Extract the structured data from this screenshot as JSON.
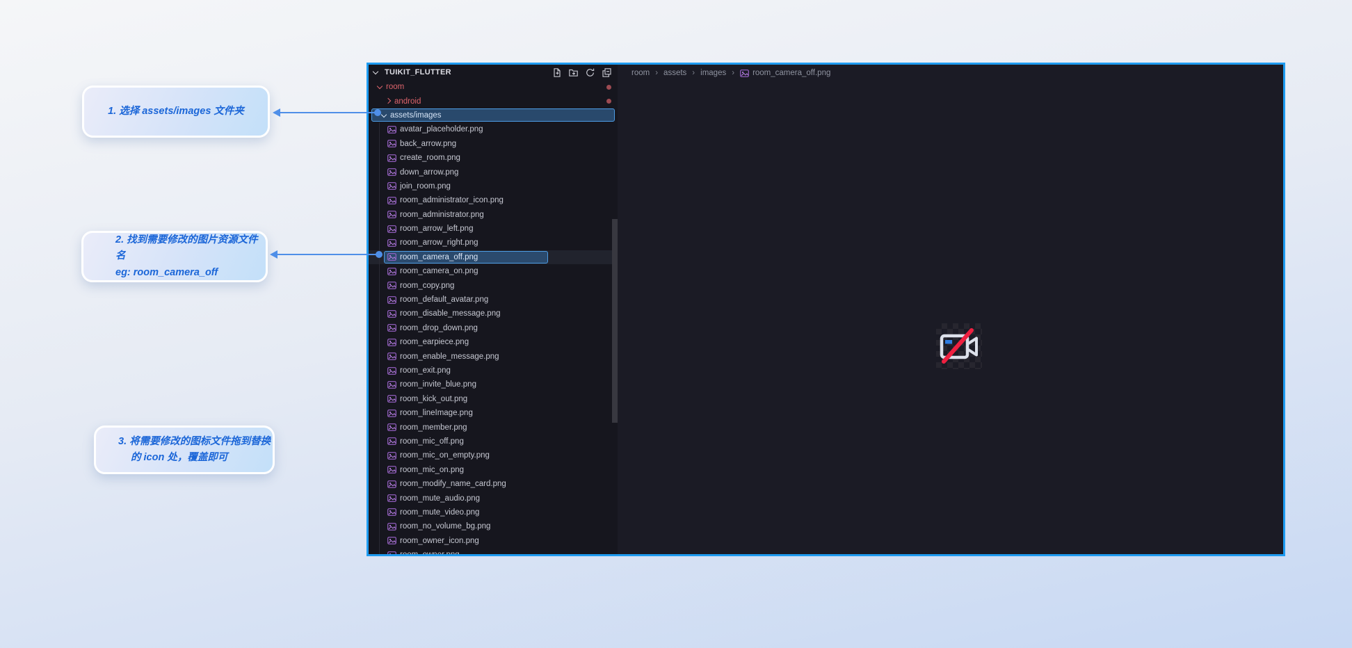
{
  "annotations": {
    "step1": {
      "line1": "1. 选择 assets/images 文件夹"
    },
    "step2": {
      "line1": "2. 找到需要修改的图片资源文件名",
      "line2": "eg: room_camera_off"
    },
    "step3": {
      "line1": "3. 将需要修改的图标文件拖到替换",
      "line2": "的 icon 处，覆盖即可"
    }
  },
  "explorer": {
    "root_label": "TUIKIT_FLUTTER",
    "toolbar": [
      {
        "name": "new-file"
      },
      {
        "name": "new-folder"
      },
      {
        "name": "refresh-explorer"
      },
      {
        "name": "collapse-folders"
      }
    ],
    "folders": {
      "root_project": {
        "label": "room",
        "state": "expanded",
        "modified": true
      },
      "android": {
        "label": "android",
        "state": "collapsed",
        "modified": true
      },
      "assets_images": {
        "label": "assets/images",
        "state": "expanded",
        "selected": true
      }
    },
    "files": [
      {
        "name": "avatar_placeholder.png"
      },
      {
        "name": "back_arrow.png"
      },
      {
        "name": "create_room.png"
      },
      {
        "name": "down_arrow.png"
      },
      {
        "name": "join_room.png"
      },
      {
        "name": "room_administrator_icon.png"
      },
      {
        "name": "room_administrator.png"
      },
      {
        "name": "room_arrow_left.png"
      },
      {
        "name": "room_arrow_right.png"
      },
      {
        "name": "room_camera_off.png",
        "selected": true
      },
      {
        "name": "room_camera_on.png"
      },
      {
        "name": "room_copy.png"
      },
      {
        "name": "room_default_avatar.png"
      },
      {
        "name": "room_disable_message.png"
      },
      {
        "name": "room_drop_down.png"
      },
      {
        "name": "room_earpiece.png"
      },
      {
        "name": "room_enable_message.png"
      },
      {
        "name": "room_exit.png"
      },
      {
        "name": "room_invite_blue.png"
      },
      {
        "name": "room_kick_out.png"
      },
      {
        "name": "room_lineImage.png"
      },
      {
        "name": "room_member.png"
      },
      {
        "name": "room_mic_off.png"
      },
      {
        "name": "room_mic_on_empty.png"
      },
      {
        "name": "room_mic_on.png"
      },
      {
        "name": "room_modify_name_card.png"
      },
      {
        "name": "room_mute_audio.png"
      },
      {
        "name": "room_mute_video.png"
      },
      {
        "name": "room_no_volume_bg.png"
      },
      {
        "name": "room_owner_icon.png"
      },
      {
        "name": "room_owner.png"
      }
    ]
  },
  "breadcrumb": {
    "items": [
      "room",
      "assets",
      "images",
      "room_camera_off.png"
    ]
  },
  "preview": {
    "filename": "room_camera_off.png",
    "icon": "camera-off"
  },
  "colors": {
    "window_border": "#1e9bf0",
    "sidebar_bg": "#16161e",
    "editor_bg": "#1b1b25",
    "selection_bg": "#2b4a6d",
    "selection_border": "#4d9ce4",
    "git_modified_text": "#de646c",
    "git_modified_dot": "#9d4b52",
    "image_icon_purple": "#9a63c9",
    "annotation_text": "#1b66d8",
    "arrow_blue": "#4f8fe8",
    "camera_stroke": "#dce0ea",
    "camera_slash_red": "#ee2040",
    "camera_detail_blue": "#2e7de2"
  }
}
